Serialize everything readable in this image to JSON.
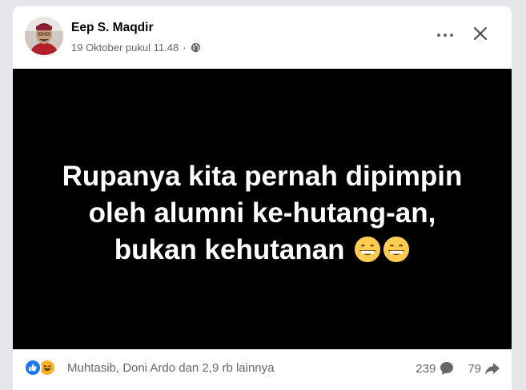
{
  "post": {
    "author": "Eep S. Maqdir",
    "timestamp": "19 Oktober pukul 11.48",
    "separator": "·",
    "audience_icon": "globe-icon",
    "menu_icon": "more-horizontal-icon",
    "close_icon": "close-icon"
  },
  "media": {
    "line1": "Rupanya kita pernah dipimpin",
    "line2": "oleh alumni ke-hutang-an,",
    "line3": "bukan kehutanan",
    "emojis": [
      "grinning-face-icon",
      "grinning-face-icon"
    ],
    "background": "#000000",
    "text_color": "#ffffff"
  },
  "footer": {
    "reaction_icons": [
      "like-icon",
      "haha-icon"
    ],
    "reaction_names": "Muhtasib, Doni Ardo dan 2,9 rb lainnya",
    "comments_count": "239",
    "shares_count": "79"
  },
  "colors": {
    "accent": "#1877f2",
    "haha": "#f7b125",
    "secondary_text": "#65676b"
  }
}
